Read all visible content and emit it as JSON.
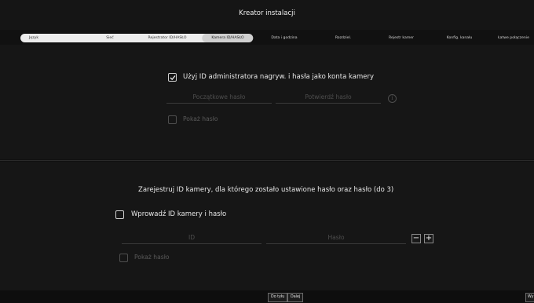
{
  "window": {
    "title": "Kreator instalacji"
  },
  "steps": [
    {
      "label": "Język"
    },
    {
      "label": "Sieć"
    },
    {
      "label": "Rejestrator ID/HASŁO"
    },
    {
      "label": "Kamera ID/HASŁO"
    },
    {
      "label": "Data i godzina"
    },
    {
      "label": "Rozdziel."
    },
    {
      "label": "Rejestr kamer"
    },
    {
      "label": "Konfig. kanału"
    },
    {
      "label": "Łatwe połączenie"
    }
  ],
  "admin_section": {
    "use_admin_label": "Użyj ID administratora nagryw. i hasła jako konta kamery",
    "initial_password_placeholder": "Początkowe hasło",
    "confirm_password_placeholder": "Potwierdź hasło",
    "info_glyph": "i",
    "show_password_label": "Pokaż hasło"
  },
  "camera_section": {
    "heading": "Zarejestruj ID kamery, dla którego zostało ustawione hasło oraz hasło (do 3)",
    "enter_id_label": "Wprowadź ID kamery i hasło",
    "id_placeholder": "ID",
    "password_placeholder": "Hasło",
    "minus_label": "−",
    "plus_label": "+",
    "show_password_label": "Pokaż hasło"
  },
  "footer": {
    "back_label": "Do tyłu",
    "next_label": "Dalej",
    "exit_label": "Wy"
  }
}
